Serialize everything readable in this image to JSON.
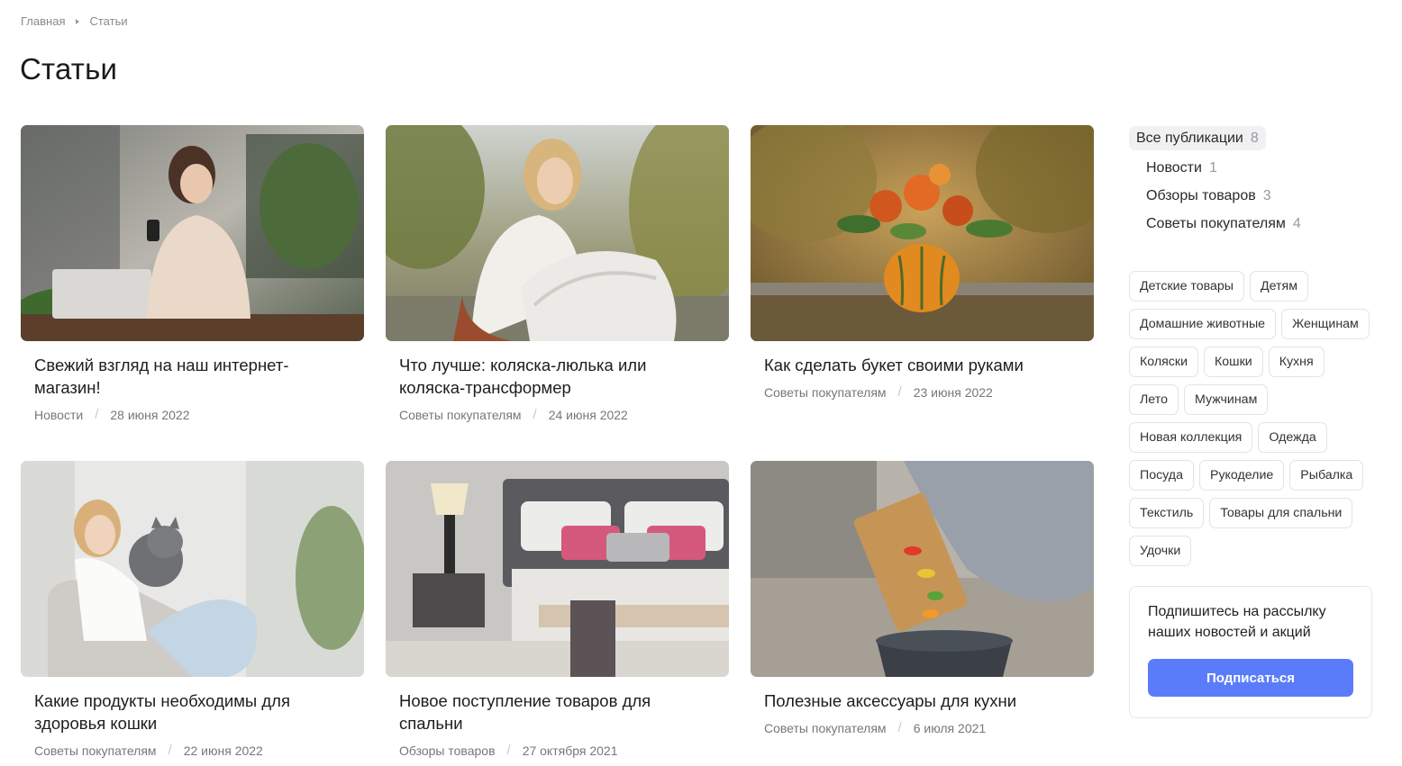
{
  "breadcrumb": {
    "home": "Главная",
    "current": "Статьи"
  },
  "page": {
    "title": "Статьи"
  },
  "articles": [
    {
      "title": "Свежий взгляд на наш интернет-магазин!",
      "category": "Новости",
      "date": "28 июня 2022",
      "image": "woman-with-phone-at-laptop"
    },
    {
      "title": "Что лучше: коляска-люлька или коляска-трансформер",
      "category": "Советы покупателям",
      "date": "24 июня 2022",
      "image": "woman-with-baby-stroller"
    },
    {
      "title": "Как сделать букет своими руками",
      "category": "Советы покупателям",
      "date": "23 июня 2022",
      "image": "autumn-bouquet-in-pumpkin"
    },
    {
      "title": "Какие продукты необходимы для здоровья кошки",
      "category": "Советы покупателям",
      "date": "22 июня 2022",
      "image": "woman-with-grey-cat"
    },
    {
      "title": "Новое поступление товаров для спальни",
      "category": "Обзоры товаров",
      "date": "27 октября 2021",
      "image": "bedroom-interior"
    },
    {
      "title": "Полезные аксессуары для кухни",
      "category": "Советы покупателям",
      "date": "6 июля 2021",
      "image": "cooking-vegetables-in-pan"
    }
  ],
  "sidebar": {
    "categories": [
      {
        "label": "Все публикации",
        "count": "8",
        "active": true
      },
      {
        "label": "Новости",
        "count": "1"
      },
      {
        "label": "Обзоры товаров",
        "count": "3"
      },
      {
        "label": "Советы покупателям",
        "count": "4"
      }
    ],
    "tags": [
      "Детские товары",
      "Детям",
      "Домашние животные",
      "Женщинам",
      "Коляски",
      "Кошки",
      "Кухня",
      "Лето",
      "Мужчинам",
      "Новая коллекция",
      "Одежда",
      "Посуда",
      "Рукоделие",
      "Рыбалка",
      "Текстиль",
      "Товары для спальни",
      "Удочки"
    ],
    "subscribe": {
      "text": "Подпишитесь на рассылку наших новостей и акций",
      "button": "Подписаться"
    }
  },
  "colors": {
    "accent": "#5b7cfa",
    "text": "#1f1f1f",
    "muted": "#777777",
    "border": "#e3e3e6"
  }
}
